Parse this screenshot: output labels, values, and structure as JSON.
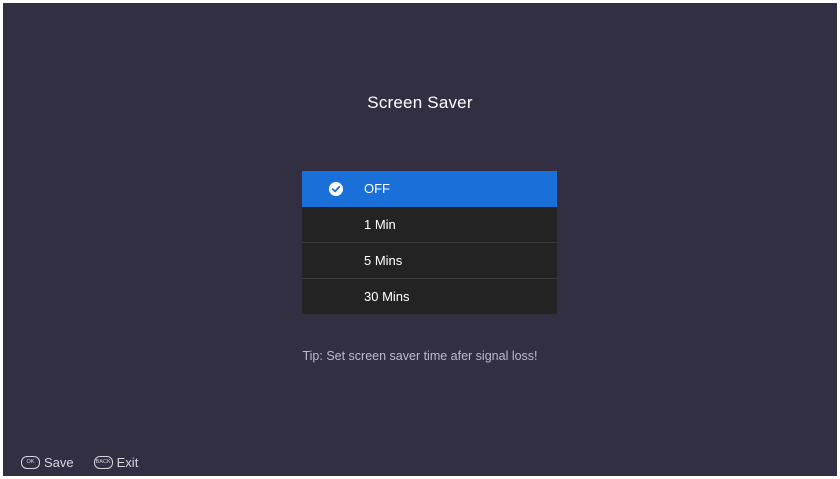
{
  "title": "Screen Saver",
  "menu": {
    "options": [
      {
        "label": "OFF",
        "selected": true
      },
      {
        "label": "1 Min",
        "selected": false
      },
      {
        "label": "5 Mins",
        "selected": false
      },
      {
        "label": "30 Mins",
        "selected": false
      }
    ]
  },
  "tip": "Tip: Set screen saver time afer signal loss!",
  "footer": {
    "save_key": "OK",
    "save_label": "Save",
    "exit_key": "BACK",
    "exit_label": "Exit"
  },
  "colors": {
    "background": "#322f43",
    "selected": "#1b6fd9",
    "item": "#232323"
  },
  "icons": {
    "check": "check-circle-icon",
    "ok_key": "ok-key-icon",
    "back_key": "back-key-icon"
  }
}
